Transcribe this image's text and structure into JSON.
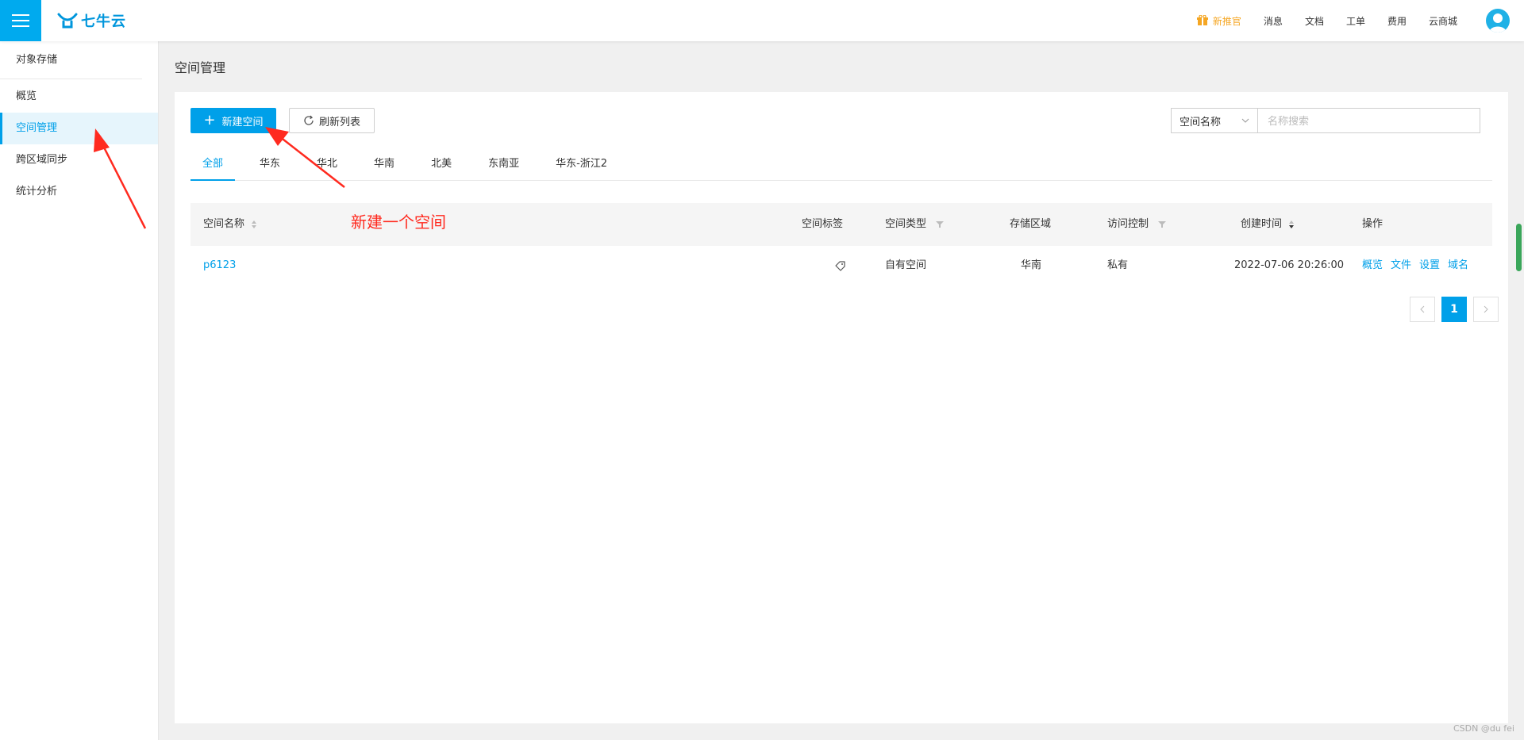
{
  "header": {
    "logo_text": "七牛云",
    "promo": "新推官",
    "nav": [
      "消息",
      "文档",
      "工单",
      "费用",
      "云商城"
    ],
    "accent_color": "#00a0e9"
  },
  "sidebar": {
    "title": "对象存储",
    "items": [
      {
        "label": "概览"
      },
      {
        "label": "空间管理",
        "active": true
      },
      {
        "label": "跨区域同步"
      },
      {
        "label": "统计分析"
      }
    ]
  },
  "page": {
    "title": "空间管理"
  },
  "toolbar": {
    "create_label": "新建空间",
    "refresh_label": "刷新列表",
    "search_type": "空间名称",
    "search_placeholder": "名称搜索"
  },
  "tabs": [
    "全部",
    "华东",
    "华北",
    "华南",
    "北美",
    "东南亚",
    "华东-浙江2"
  ],
  "table": {
    "columns": [
      "空间名称",
      "空间标签",
      "空间类型",
      "存储区域",
      "访问控制",
      "创建时间",
      "操作"
    ],
    "rows": [
      {
        "name": "p6123",
        "type": "自有空间",
        "region": "华南",
        "access": "私有",
        "created": "2022-07-06 20:26:00",
        "ops": [
          "概览",
          "文件",
          "设置",
          "域名"
        ]
      }
    ]
  },
  "pagination": {
    "current": "1"
  },
  "annotation": {
    "text": "新建一个空间",
    "color": "#ff2a1f"
  },
  "watermark": "CSDN @du fei"
}
